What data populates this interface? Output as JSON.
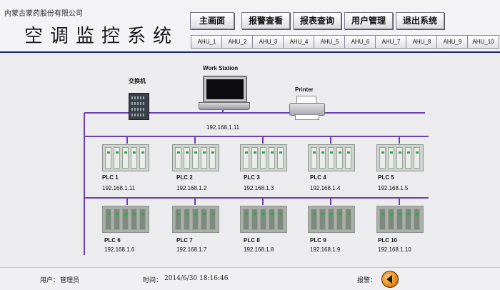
{
  "header": {
    "company": "内蒙古蒙药股份有限公司",
    "title": "空调监控系统"
  },
  "nav_buttons": [
    "主画面",
    "报警查看",
    "报表查询",
    "用户管理",
    "退出系统"
  ],
  "ahu_tabs": [
    "AHU_1",
    "AHU_2",
    "AHU_3",
    "AHU_4",
    "AHU_5",
    "AHU_6",
    "AHU_7",
    "AHU_8",
    "AHU_9",
    "AHU_10"
  ],
  "network": {
    "switch_label": "交换机",
    "workstation_label": "Work Station",
    "workstation_ip": "192.168.1.11",
    "printer_label": "Printer",
    "plcs": [
      {
        "name": "PLC 1",
        "ip": "192.168.1.11"
      },
      {
        "name": "PLC 2",
        "ip": "192.168.1.2"
      },
      {
        "name": "PLC 3",
        "ip": "192.168.1.3"
      },
      {
        "name": "PLC 4",
        "ip": "192.168.1.4"
      },
      {
        "name": "PLC 5",
        "ip": "192.168.1.5"
      },
      {
        "name": "PLC 6",
        "ip": "192.168.1.6"
      },
      {
        "name": "PLC 7",
        "ip": "192.168.1.7"
      },
      {
        "name": "PLC 8",
        "ip": "192.168.1.8"
      },
      {
        "name": "PLC 9",
        "ip": "192.168.1.9"
      },
      {
        "name": "PLC 10",
        "ip": "192.168.1.10"
      }
    ],
    "line_color": "#6a3fb8"
  },
  "footer": {
    "user_label": "用户：",
    "user_value": "管理员",
    "time_label": "时间：",
    "time_value": "2014/6/30 18:16:46",
    "alarm_label": "报警："
  }
}
